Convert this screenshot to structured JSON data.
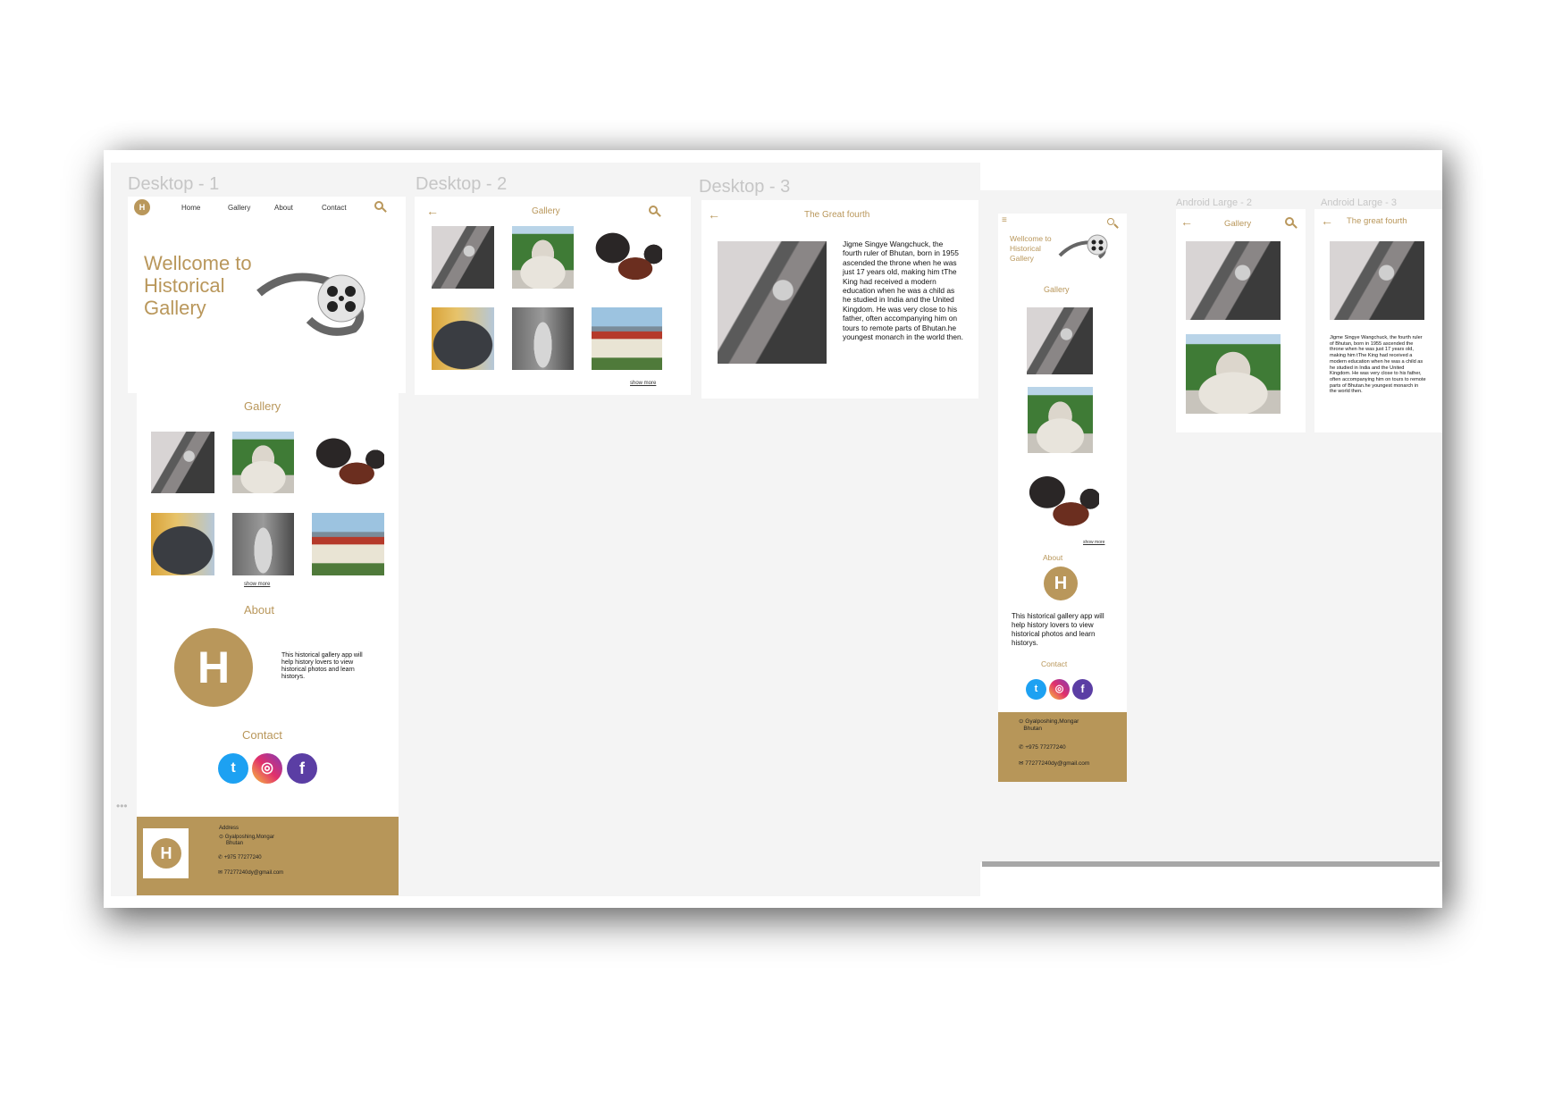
{
  "frames": {
    "desktop1": "Desktop - 1",
    "desktop2": "Desktop - 2",
    "desktop3": "Desktop - 3",
    "android2": "Android Large - 2",
    "android3": "Android Large - 3"
  },
  "nav": {
    "home": "Home",
    "gallery": "Gallery",
    "about": "About",
    "contact": "Contact"
  },
  "hero": {
    "line1": "Wellcome to",
    "line2": "Historical",
    "line3": "Gallery"
  },
  "sections": {
    "gallery": "Gallery",
    "about": "About",
    "contact": "Contact",
    "show_more": "show more"
  },
  "about_text": "This historical gallery app will help history lovers to view historical photos and learn historys.",
  "footer": {
    "address_label": "Address",
    "address": "Gyalposhing,Mongar",
    "country": "Bhutan",
    "phone": "+975 77277240",
    "email": "77277240dy@gmail.com"
  },
  "detail": {
    "title_desktop": "The Great fourth",
    "title_mobile": "The great fourth",
    "text": "Jigme Singye Wangchuck, the fourth ruler of Bhutan, born in 1955 ascended the throne when he was just 17 years old, making him tThe King had received a modern education when he was a child as he studied in India and the United Kingdom. He was very close to his father, often accompanying him on tours to remote parts of Bhutan.he youngest monarch in the world then."
  },
  "social": {
    "twitter": "twitter-icon",
    "instagram": "instagram-icon",
    "facebook": "facebook-icon"
  },
  "colors": {
    "accent": "#b9975b",
    "footer": "#b79659"
  }
}
